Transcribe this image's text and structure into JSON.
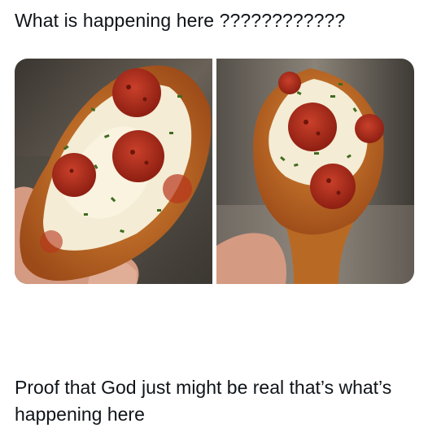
{
  "post": {
    "header_text": "What is happening here ????????????",
    "caption_text": "Proof that God just might be real that’s what’s happening here"
  },
  "images": [
    {
      "name": "pepperoni-pizza-chicken-drumstick-photo-1"
    },
    {
      "name": "pepperoni-pizza-chicken-drumstick-photo-2"
    }
  ],
  "colors": {
    "text": "#0f1419",
    "background": "#ffffff",
    "crust": "#c7752a",
    "cheese": "#f4ecd4",
    "pepperoni": "#b22a18",
    "herbs": "#3f6b1e"
  }
}
